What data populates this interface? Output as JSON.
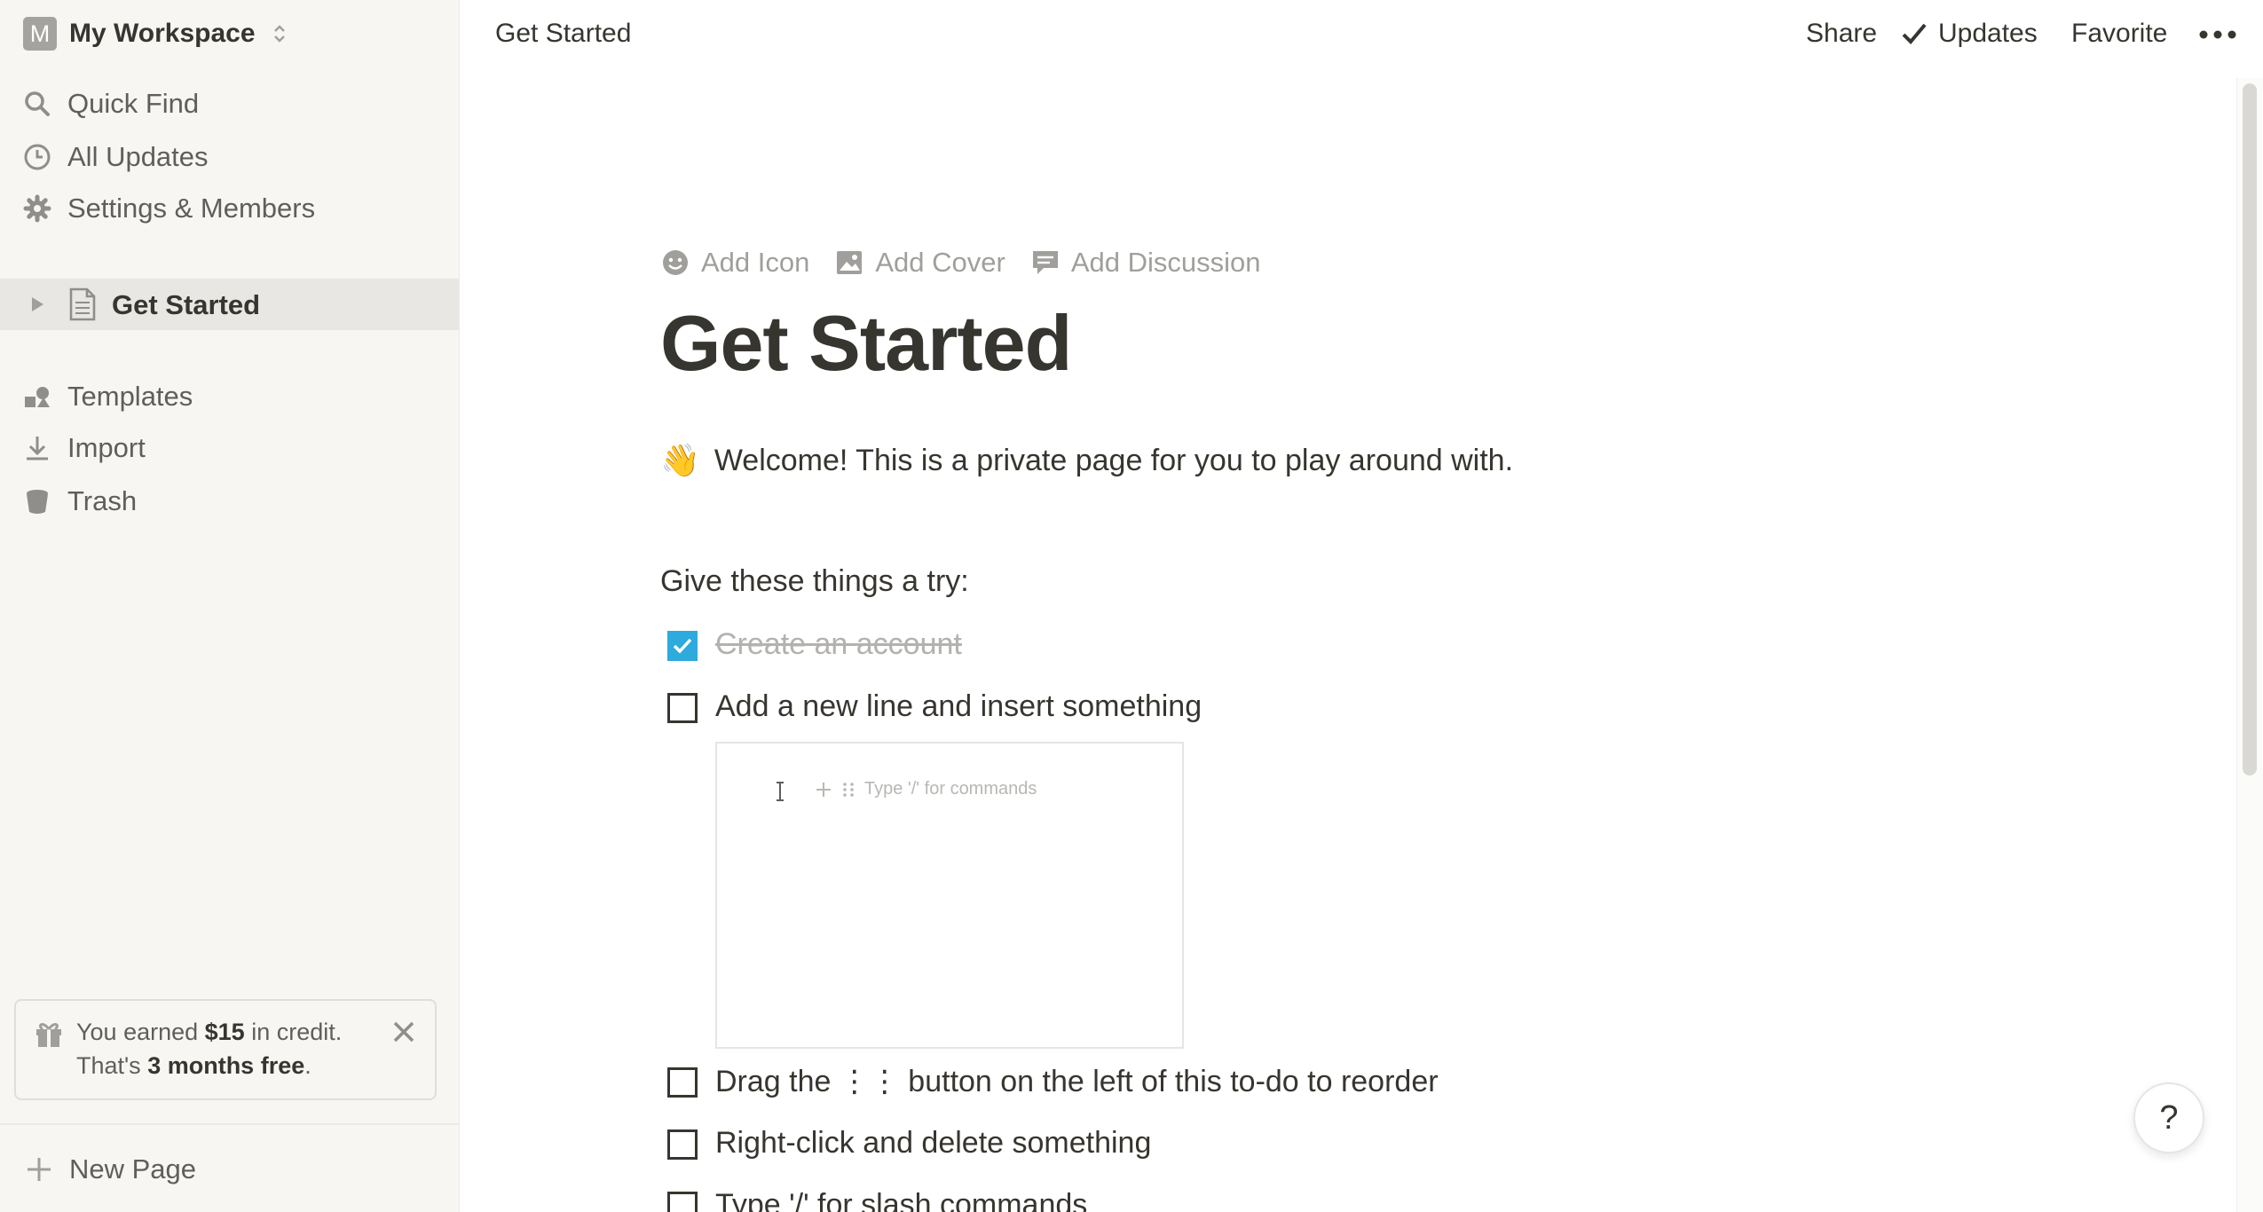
{
  "sidebar": {
    "workspace": {
      "avatar_letter": "M",
      "name": "My Workspace"
    },
    "nav": [
      {
        "label": "Quick Find",
        "icon": "search-icon"
      },
      {
        "label": "All Updates",
        "icon": "clock-icon"
      },
      {
        "label": "Settings & Members",
        "icon": "gear-icon"
      }
    ],
    "pages": [
      {
        "label": "Get Started",
        "icon": "document-icon"
      }
    ],
    "tools": [
      {
        "label": "Templates",
        "icon": "templates-icon"
      },
      {
        "label": "Import",
        "icon": "download-icon"
      },
      {
        "label": "Trash",
        "icon": "trash-icon"
      }
    ],
    "credit": {
      "prefix": "You earned ",
      "amount": "$15",
      "suffix": " in credit.",
      "line2_prefix": "That's ",
      "line2_bold": "3 months free",
      "line2_suffix": "."
    },
    "new_page": "New Page"
  },
  "topbar": {
    "breadcrumb": "Get Started",
    "share": "Share",
    "updates": "Updates",
    "favorite": "Favorite"
  },
  "page": {
    "actions": {
      "add_icon": "Add Icon",
      "add_cover": "Add Cover",
      "add_discussion": "Add Discussion"
    },
    "title": "Get Started",
    "welcome_emoji": "👋",
    "welcome": "Welcome! This is a private page for you to play around with.",
    "subheading": "Give these things a try:",
    "todos": [
      {
        "label": "Create an account",
        "checked": true
      },
      {
        "label": "Add a new line and insert something",
        "checked": false
      },
      {
        "label": "Drag the ⋮⋮ button on the left of this to-do to reorder",
        "checked": false
      },
      {
        "label": "Right-click and delete something",
        "checked": false
      },
      {
        "label": "Type '/' for slash commands",
        "checked": false
      }
    ],
    "embed_placeholder": "Type '/' for commands"
  },
  "help": "?",
  "colors": {
    "accent": "#2eaadc",
    "sidebar_bg": "#f7f6f3",
    "text": "#37352f"
  }
}
